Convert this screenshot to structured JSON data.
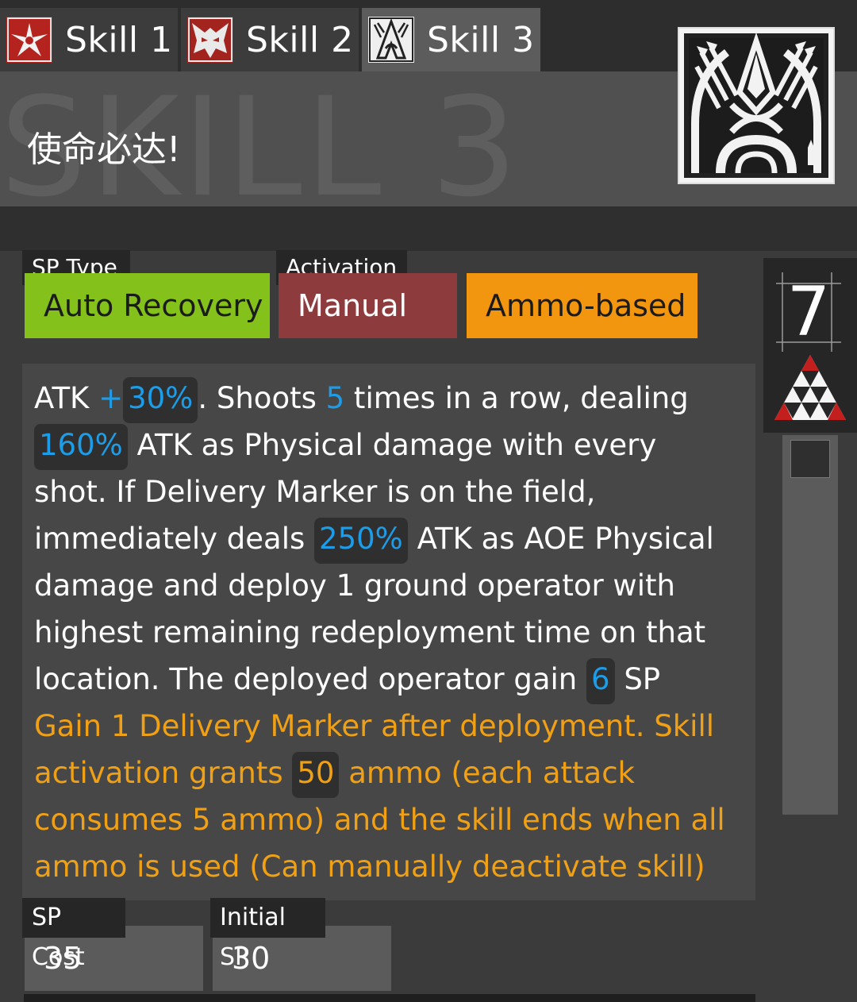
{
  "tabs": [
    {
      "label": "Skill 1",
      "icon": "red-winged-emblem-icon",
      "active": false
    },
    {
      "label": "Skill 2",
      "icon": "red-beast-mask-icon",
      "active": false
    },
    {
      "label": "Skill 3",
      "icon": "white-arrow-crest-icon",
      "active": true
    }
  ],
  "header": {
    "background_text": "SKILL 3",
    "skill_name": "使命必达!",
    "skill_icon": "arrow-crest-icon"
  },
  "badges": {
    "sp_type_label": "SP Type",
    "sp_type_value": "Auto Recovery",
    "activation_label": "Activation",
    "activation_value": "Manual",
    "charge_value": "Ammo-based"
  },
  "level": {
    "value": "7",
    "icon": "mastery-triangle-icon"
  },
  "description": {
    "l1_a": "ATK ",
    "l1_plus": "+",
    "l1_v1": "30%",
    "l1_b": ". Shoots ",
    "l1_v2": "5",
    "l1_c": " times in a row, dealing",
    "l2_v": "160%",
    "l2_a": " ATK as Physical damage with every",
    "l3": "shot. If Delivery Marker is on the field,",
    "l4_a": "immediately deals ",
    "l4_v": "250%",
    "l4_b": " ATK as AOE Physical",
    "l5": "damage and deploy 1 ground operator with",
    "l6": "highest remaining redeployment time on that",
    "l7_a": "location. The deployed operator gain ",
    "l7_v": "6",
    "l7_b": " SP",
    "l8": "Gain 1 Delivery Marker after deployment. Skill",
    "l9_a": "activation grants ",
    "l9_v": "50",
    "l9_b": " ammo (each attack",
    "l10": "consumes 5 ammo) and the skill ends when all",
    "l11": "ammo is used (Can manually deactivate skill)"
  },
  "cost": {
    "sp_cost_label": "SP Cost",
    "sp_cost_value": "35",
    "initial_sp_label": "Initial SP",
    "initial_sp_value": "30"
  },
  "colors": {
    "auto_recovery": "#84c11a",
    "manual": "#8e3b3e",
    "ammo_based": "#f2960f",
    "highlight_blue": "#1d9ce8",
    "trait_orange": "#f0a015"
  }
}
